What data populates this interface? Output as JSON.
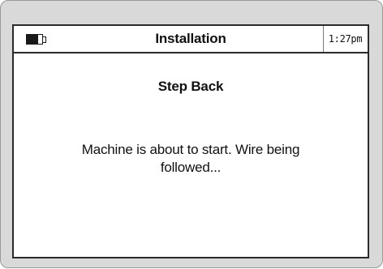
{
  "header": {
    "title": "Installation",
    "time": "1:27pm",
    "battery_level": 0.75,
    "battery_icon": "battery-icon"
  },
  "screen": {
    "heading": "Step Back",
    "message": "Machine is about to start. Wire being followed..."
  },
  "colors": {
    "bezel": "#d9d9d9",
    "screen": "#ffffff",
    "border": "#2b2b2b",
    "text": "#111111"
  }
}
